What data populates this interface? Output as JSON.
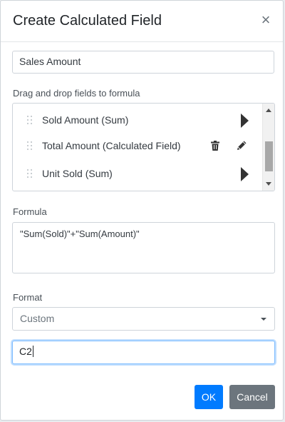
{
  "dialog": {
    "title": "Create Calculated Field",
    "close_glyph": "×"
  },
  "field_name": {
    "value": "Sales Amount"
  },
  "fields": {
    "label": "Drag and drop fields to formula",
    "items": [
      {
        "label": "Sold Amount (Sum)"
      },
      {
        "label": "Total Amount (Calculated Field)"
      },
      {
        "label": "Unit Sold (Sum)"
      }
    ]
  },
  "formula": {
    "label": "Formula",
    "value": "\"Sum(Sold)\"+\"Sum(Amount)\""
  },
  "format": {
    "label": "Format",
    "selected": "Custom",
    "custom_value": "C2"
  },
  "buttons": {
    "ok": "OK",
    "cancel": "Cancel"
  },
  "colors": {
    "primary": "#007bff",
    "secondary": "#6c757d"
  },
  "icons": {
    "close": "close-icon",
    "grip": "drag-handle-icon",
    "expand": "expand-arrow-icon",
    "delete": "trash-icon",
    "edit": "pencil-icon",
    "dropdown": "chevron-down-icon"
  }
}
